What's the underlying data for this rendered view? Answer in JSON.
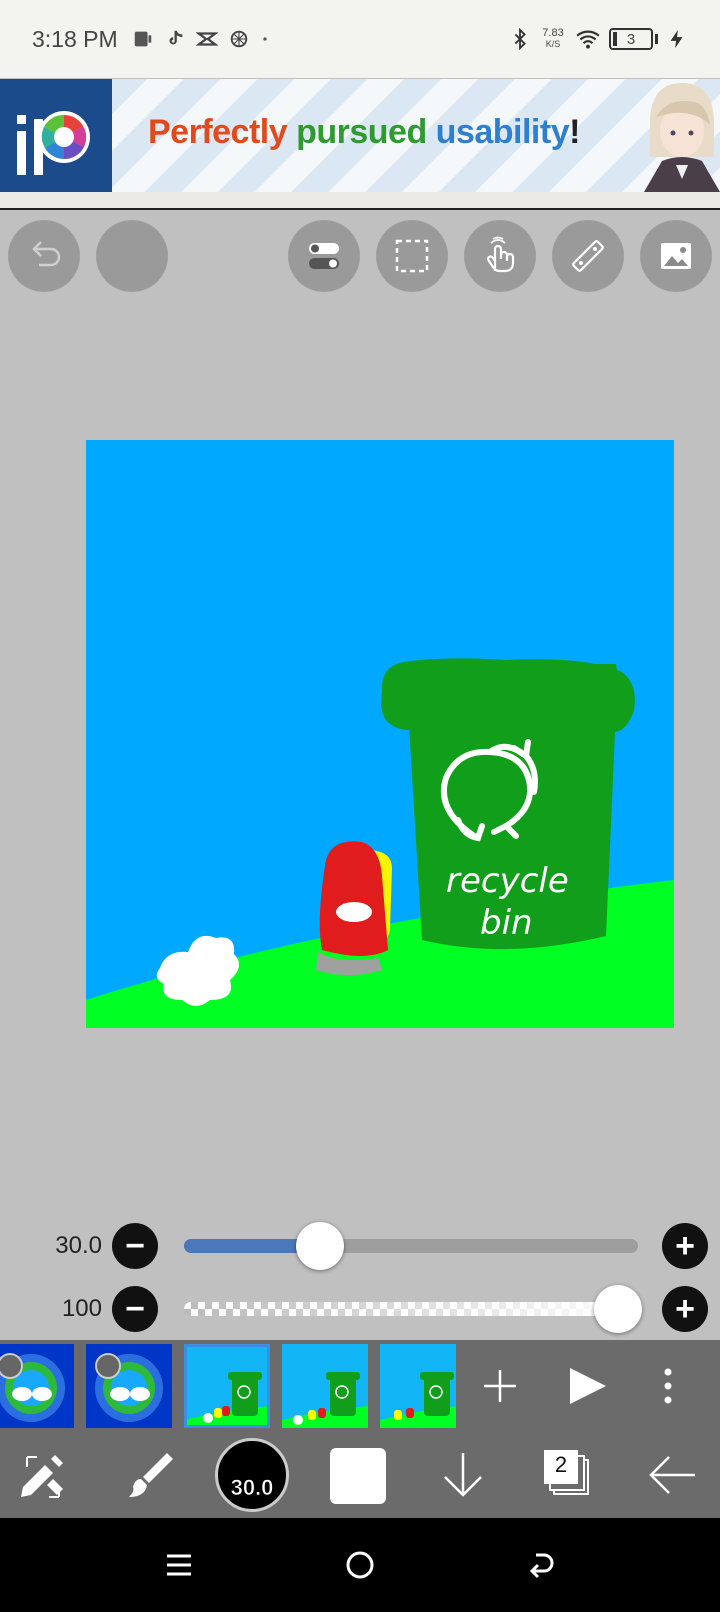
{
  "status_bar": {
    "time": "3:18 PM",
    "net_speed_value": "7.83",
    "net_speed_unit": "K/S",
    "battery": "3",
    "left_icons": [
      "notification-icon",
      "tiktok-icon",
      "capcut-icon",
      "openai-icon",
      "dot-icon"
    ],
    "right_icons": [
      "bluetooth-icon",
      "wifi-icon",
      "battery-icon",
      "charging-icon"
    ]
  },
  "ad": {
    "word1": "Perfectly",
    "word2": "pursued",
    "word3": "usability",
    "word4": "!",
    "colors": {
      "word1": "#e04a1c",
      "word2": "#2f9a2f",
      "word3": "#2f7fd0"
    }
  },
  "toolbar": {
    "icons": [
      "undo-icon",
      "empty-icon",
      "toggle-icon",
      "selection-icon",
      "hand-icon",
      "ruler-icon",
      "image-icon"
    ]
  },
  "canvas": {
    "sky_color": "#00a8ff",
    "grass_color": "#00ff22",
    "bin_color": "#119e1a",
    "bin_label_line1": "recycle",
    "bin_label_line2": "bin"
  },
  "sliders": {
    "size": {
      "value": "30.0",
      "level": 0.3
    },
    "opacity": {
      "value": "100",
      "level": 1.0
    }
  },
  "frames": {
    "count_visible": 5,
    "active_index": 2
  },
  "bottom_bar": {
    "brush_size": "30.0",
    "color": "#ffffff",
    "layers_count": "2",
    "icons": [
      "transform-tool-icon",
      "brush-icon",
      "brush-size-indicator",
      "color-swatch",
      "arrow-down-icon",
      "layers-icon",
      "back-arrow-icon"
    ]
  },
  "nav": {
    "icons": [
      "menu-icon",
      "home-icon",
      "back-icon"
    ]
  }
}
